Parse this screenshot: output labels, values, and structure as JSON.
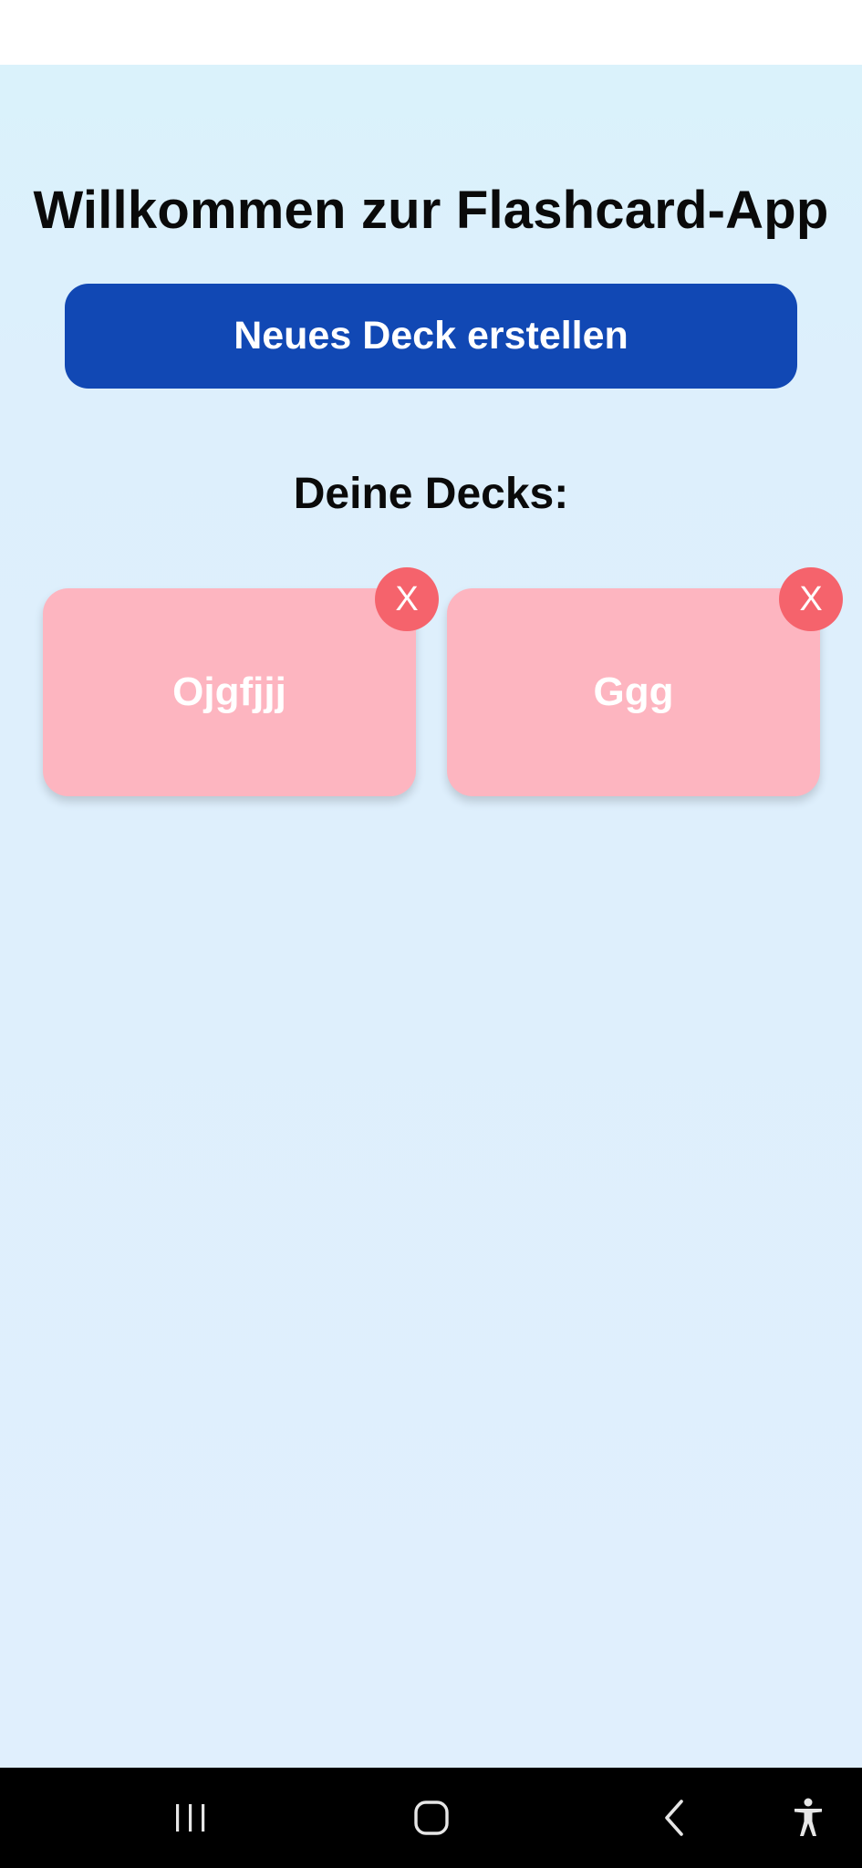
{
  "app": {
    "title": "Willkommen zur Flashcard-App",
    "new_deck_button": "Neues Deck erstellen",
    "decks_heading": "Deine Decks:",
    "decks": [
      {
        "name": "Ojgfjjj",
        "delete_label": "X"
      },
      {
        "name": "Ggg",
        "delete_label": "X"
      }
    ]
  },
  "colors": {
    "background": "#ddeffc",
    "primary_button": "#1148b4",
    "deck_card": "#fdb5c0",
    "delete_button": "#f5636c"
  },
  "nav_bar": {
    "icons": [
      "recent-apps-icon",
      "home-icon",
      "back-icon",
      "accessibility-icon"
    ]
  }
}
